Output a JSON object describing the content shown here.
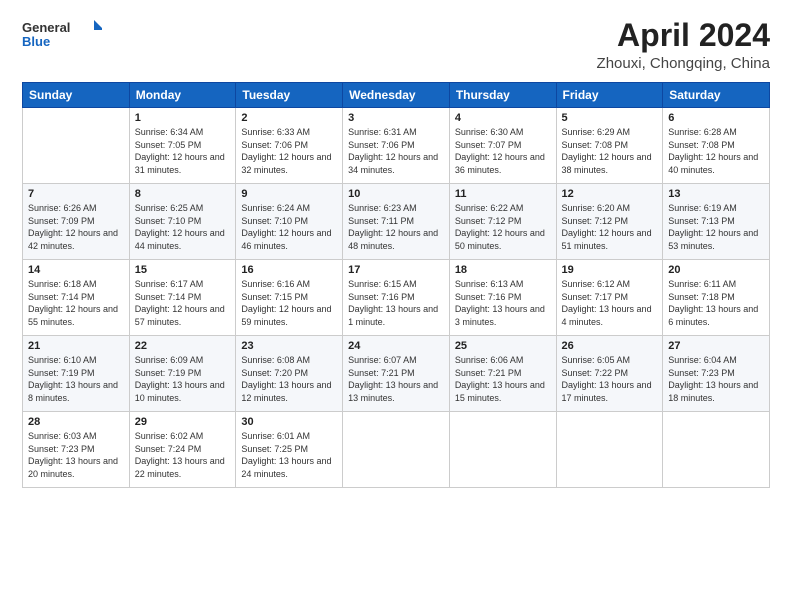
{
  "logo": {
    "line1": "General",
    "line2": "Blue"
  },
  "title": "April 2024",
  "subtitle": "Zhouxi, Chongqing, China",
  "days": [
    "Sunday",
    "Monday",
    "Tuesday",
    "Wednesday",
    "Thursday",
    "Friday",
    "Saturday"
  ],
  "weeks": [
    [
      {
        "num": "",
        "sunrise": "",
        "sunset": "",
        "daylight": ""
      },
      {
        "num": "1",
        "sunrise": "Sunrise: 6:34 AM",
        "sunset": "Sunset: 7:05 PM",
        "daylight": "Daylight: 12 hours and 31 minutes."
      },
      {
        "num": "2",
        "sunrise": "Sunrise: 6:33 AM",
        "sunset": "Sunset: 7:06 PM",
        "daylight": "Daylight: 12 hours and 32 minutes."
      },
      {
        "num": "3",
        "sunrise": "Sunrise: 6:31 AM",
        "sunset": "Sunset: 7:06 PM",
        "daylight": "Daylight: 12 hours and 34 minutes."
      },
      {
        "num": "4",
        "sunrise": "Sunrise: 6:30 AM",
        "sunset": "Sunset: 7:07 PM",
        "daylight": "Daylight: 12 hours and 36 minutes."
      },
      {
        "num": "5",
        "sunrise": "Sunrise: 6:29 AM",
        "sunset": "Sunset: 7:08 PM",
        "daylight": "Daylight: 12 hours and 38 minutes."
      },
      {
        "num": "6",
        "sunrise": "Sunrise: 6:28 AM",
        "sunset": "Sunset: 7:08 PM",
        "daylight": "Daylight: 12 hours and 40 minutes."
      }
    ],
    [
      {
        "num": "7",
        "sunrise": "Sunrise: 6:26 AM",
        "sunset": "Sunset: 7:09 PM",
        "daylight": "Daylight: 12 hours and 42 minutes."
      },
      {
        "num": "8",
        "sunrise": "Sunrise: 6:25 AM",
        "sunset": "Sunset: 7:10 PM",
        "daylight": "Daylight: 12 hours and 44 minutes."
      },
      {
        "num": "9",
        "sunrise": "Sunrise: 6:24 AM",
        "sunset": "Sunset: 7:10 PM",
        "daylight": "Daylight: 12 hours and 46 minutes."
      },
      {
        "num": "10",
        "sunrise": "Sunrise: 6:23 AM",
        "sunset": "Sunset: 7:11 PM",
        "daylight": "Daylight: 12 hours and 48 minutes."
      },
      {
        "num": "11",
        "sunrise": "Sunrise: 6:22 AM",
        "sunset": "Sunset: 7:12 PM",
        "daylight": "Daylight: 12 hours and 50 minutes."
      },
      {
        "num": "12",
        "sunrise": "Sunrise: 6:20 AM",
        "sunset": "Sunset: 7:12 PM",
        "daylight": "Daylight: 12 hours and 51 minutes."
      },
      {
        "num": "13",
        "sunrise": "Sunrise: 6:19 AM",
        "sunset": "Sunset: 7:13 PM",
        "daylight": "Daylight: 12 hours and 53 minutes."
      }
    ],
    [
      {
        "num": "14",
        "sunrise": "Sunrise: 6:18 AM",
        "sunset": "Sunset: 7:14 PM",
        "daylight": "Daylight: 12 hours and 55 minutes."
      },
      {
        "num": "15",
        "sunrise": "Sunrise: 6:17 AM",
        "sunset": "Sunset: 7:14 PM",
        "daylight": "Daylight: 12 hours and 57 minutes."
      },
      {
        "num": "16",
        "sunrise": "Sunrise: 6:16 AM",
        "sunset": "Sunset: 7:15 PM",
        "daylight": "Daylight: 12 hours and 59 minutes."
      },
      {
        "num": "17",
        "sunrise": "Sunrise: 6:15 AM",
        "sunset": "Sunset: 7:16 PM",
        "daylight": "Daylight: 13 hours and 1 minute."
      },
      {
        "num": "18",
        "sunrise": "Sunrise: 6:13 AM",
        "sunset": "Sunset: 7:16 PM",
        "daylight": "Daylight: 13 hours and 3 minutes."
      },
      {
        "num": "19",
        "sunrise": "Sunrise: 6:12 AM",
        "sunset": "Sunset: 7:17 PM",
        "daylight": "Daylight: 13 hours and 4 minutes."
      },
      {
        "num": "20",
        "sunrise": "Sunrise: 6:11 AM",
        "sunset": "Sunset: 7:18 PM",
        "daylight": "Daylight: 13 hours and 6 minutes."
      }
    ],
    [
      {
        "num": "21",
        "sunrise": "Sunrise: 6:10 AM",
        "sunset": "Sunset: 7:19 PM",
        "daylight": "Daylight: 13 hours and 8 minutes."
      },
      {
        "num": "22",
        "sunrise": "Sunrise: 6:09 AM",
        "sunset": "Sunset: 7:19 PM",
        "daylight": "Daylight: 13 hours and 10 minutes."
      },
      {
        "num": "23",
        "sunrise": "Sunrise: 6:08 AM",
        "sunset": "Sunset: 7:20 PM",
        "daylight": "Daylight: 13 hours and 12 minutes."
      },
      {
        "num": "24",
        "sunrise": "Sunrise: 6:07 AM",
        "sunset": "Sunset: 7:21 PM",
        "daylight": "Daylight: 13 hours and 13 minutes."
      },
      {
        "num": "25",
        "sunrise": "Sunrise: 6:06 AM",
        "sunset": "Sunset: 7:21 PM",
        "daylight": "Daylight: 13 hours and 15 minutes."
      },
      {
        "num": "26",
        "sunrise": "Sunrise: 6:05 AM",
        "sunset": "Sunset: 7:22 PM",
        "daylight": "Daylight: 13 hours and 17 minutes."
      },
      {
        "num": "27",
        "sunrise": "Sunrise: 6:04 AM",
        "sunset": "Sunset: 7:23 PM",
        "daylight": "Daylight: 13 hours and 18 minutes."
      }
    ],
    [
      {
        "num": "28",
        "sunrise": "Sunrise: 6:03 AM",
        "sunset": "Sunset: 7:23 PM",
        "daylight": "Daylight: 13 hours and 20 minutes."
      },
      {
        "num": "29",
        "sunrise": "Sunrise: 6:02 AM",
        "sunset": "Sunset: 7:24 PM",
        "daylight": "Daylight: 13 hours and 22 minutes."
      },
      {
        "num": "30",
        "sunrise": "Sunrise: 6:01 AM",
        "sunset": "Sunset: 7:25 PM",
        "daylight": "Daylight: 13 hours and 24 minutes."
      },
      {
        "num": "",
        "sunrise": "",
        "sunset": "",
        "daylight": ""
      },
      {
        "num": "",
        "sunrise": "",
        "sunset": "",
        "daylight": ""
      },
      {
        "num": "",
        "sunrise": "",
        "sunset": "",
        "daylight": ""
      },
      {
        "num": "",
        "sunrise": "",
        "sunset": "",
        "daylight": ""
      }
    ]
  ]
}
